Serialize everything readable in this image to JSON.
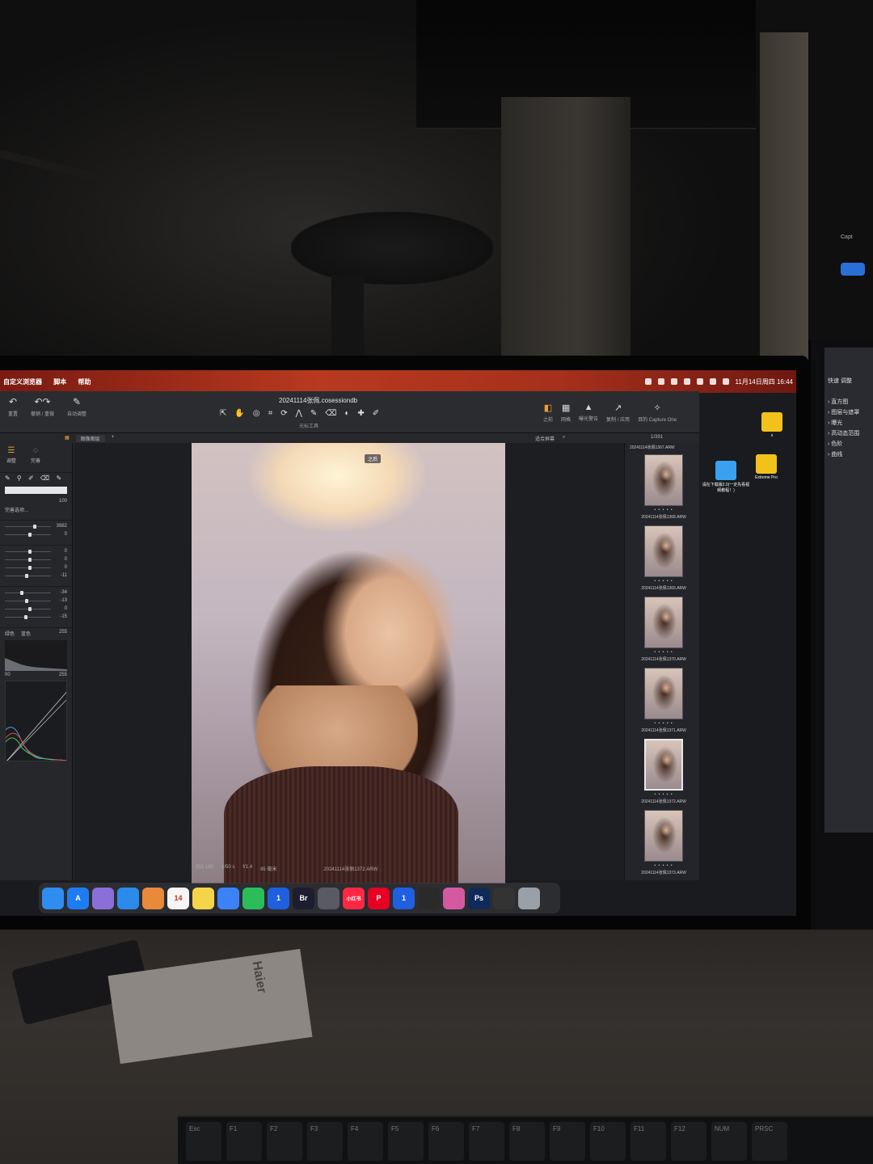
{
  "menubar": {
    "items": [
      "自定义浏览器",
      "脚本",
      "帮助"
    ],
    "clock": "11月14日周四 16:44"
  },
  "app": {
    "document_title": "20241114张佩.cosessiondb",
    "toolbar_left": [
      {
        "label": "重置",
        "icon": "reset-icon"
      },
      {
        "label": "撤销 / 重做",
        "icon": "undo-redo-icon"
      },
      {
        "label": "自动调整",
        "icon": "auto-adjust-icon"
      }
    ],
    "toolbar_center_label": "光标工具",
    "toolbar_right": [
      {
        "label": "之前",
        "icon": "before-icon"
      },
      {
        "label": "网格",
        "icon": "grid-icon"
      },
      {
        "label": "曝光警告",
        "icon": "exposure-warning-icon"
      },
      {
        "label": "复制 / 应用",
        "icon": "copy-apply-icon"
      },
      {
        "label": "目的 Capture One",
        "icon": "capture-one-icon"
      }
    ],
    "subbar": {
      "view_mode": "图像图层",
      "fit_label": "适合屏幕",
      "counter": "1/391"
    },
    "left_panel": {
      "tabs": [
        {
          "label": "调整"
        },
        {
          "label": "完善"
        }
      ],
      "sliders_a": [
        {
          "value": "3982",
          "fraction": 0.62
        },
        {
          "value": "0",
          "fraction": 0.5
        }
      ],
      "sliders_b": [
        {
          "value": "0",
          "fraction": 0.5
        },
        {
          "value": "0",
          "fraction": 0.5
        },
        {
          "value": "0",
          "fraction": 0.5
        },
        {
          "value": "-11",
          "fraction": 0.44
        }
      ],
      "sliders_c": [
        {
          "value": "-34",
          "fraction": 0.33
        },
        {
          "value": "-13",
          "fraction": 0.44
        },
        {
          "value": "0",
          "fraction": 0.5
        },
        {
          "value": "-15",
          "fraction": 0.42
        }
      ],
      "level_value": "100",
      "preset_label": "完善选项...",
      "curve_labels": [
        "绿色",
        "蓝色"
      ],
      "curve_max": "255",
      "curve_min": "00",
      "curve_max2": "255"
    },
    "viewer": {
      "after_badge": "之后",
      "meta": [
        "ISO 160",
        "1/50 s",
        "f/1.4",
        "85 毫米"
      ],
      "filename": "20241114张佩1372.ARW"
    },
    "browser": {
      "header_name": "20241114张佩1367.ARW",
      "thumbnails": [
        {
          "name": "20241114张佩1368.ARW",
          "selected": false
        },
        {
          "name": "20241114张佩1369.ARW",
          "selected": false
        },
        {
          "name": "20241114张佩1370.ARW",
          "selected": false
        },
        {
          "name": "20241114张佩1371.ARW",
          "selected": false
        },
        {
          "name": "20241114张佩1372.ARW",
          "selected": true
        },
        {
          "name": "20241114张佩1373.ARW",
          "selected": false
        }
      ],
      "stars": "• • • • •"
    }
  },
  "desktop": {
    "icons": [
      {
        "label": "x",
        "color": "#f2c21b"
      },
      {
        "label": "请在下载版2.0(一定先看视频教程！)",
        "color": "#3aa0f0"
      },
      {
        "label": "Extreme Pro",
        "color": "#f2c21b"
      }
    ]
  },
  "dock": {
    "apps": [
      {
        "name": "finder",
        "label": "",
        "color": "#2f8cf0"
      },
      {
        "name": "app-store",
        "label": "A",
        "color": "#1e7cf2"
      },
      {
        "name": "launchpad",
        "label": "",
        "color": "#8a6fd8"
      },
      {
        "name": "safari",
        "label": "",
        "color": "#2a8bea"
      },
      {
        "name": "photos",
        "label": "",
        "color": "#e88a3a"
      },
      {
        "name": "calendar",
        "label": "14",
        "color": "#f5f5f5"
      },
      {
        "name": "notes",
        "label": "",
        "color": "#f5d44a"
      },
      {
        "name": "baidu-netdisk",
        "label": "",
        "color": "#3b82f6"
      },
      {
        "name": "wechat",
        "label": "",
        "color": "#2bbd5a"
      },
      {
        "name": "1password",
        "label": "1",
        "color": "#1f5fe0"
      },
      {
        "name": "bridge",
        "label": "Br",
        "color": "#1d1d30"
      },
      {
        "name": "chatgpt",
        "label": "",
        "color": "#5a5a62"
      },
      {
        "name": "xiaohongshu",
        "label": "小红书",
        "color": "#ff2742"
      },
      {
        "name": "pinterest",
        "label": "P",
        "color": "#e60023"
      },
      {
        "name": "1password-2",
        "label": "1",
        "color": "#1f5fe0"
      },
      {
        "name": "final-cut",
        "label": "",
        "color": "#2a2a2a"
      },
      {
        "name": "pixelmator",
        "label": "",
        "color": "#d35aa0"
      },
      {
        "name": "photoshop",
        "label": "Ps",
        "color": "#0f2a5a"
      },
      {
        "name": "capture-one",
        "label": "",
        "color": "#333"
      },
      {
        "name": "trash",
        "label": "",
        "color": "#9aa0a8"
      }
    ]
  },
  "side_monitor": {
    "top_text": "Capt",
    "panel_items": [
      "直方图",
      "图层与遮罩",
      "曝光",
      "高动态范围",
      "色阶",
      "曲线"
    ],
    "tab_labels": [
      "快速",
      "调整"
    ]
  },
  "keyboard": {
    "keys": [
      "Esc",
      "F1",
      "F2",
      "F3",
      "F4",
      "F5",
      "F6",
      "F7",
      "F8",
      "F9",
      "F10",
      "F11",
      "F12",
      "NUM",
      "PRSC"
    ]
  },
  "desk": {
    "paper_brand": "Haier"
  }
}
